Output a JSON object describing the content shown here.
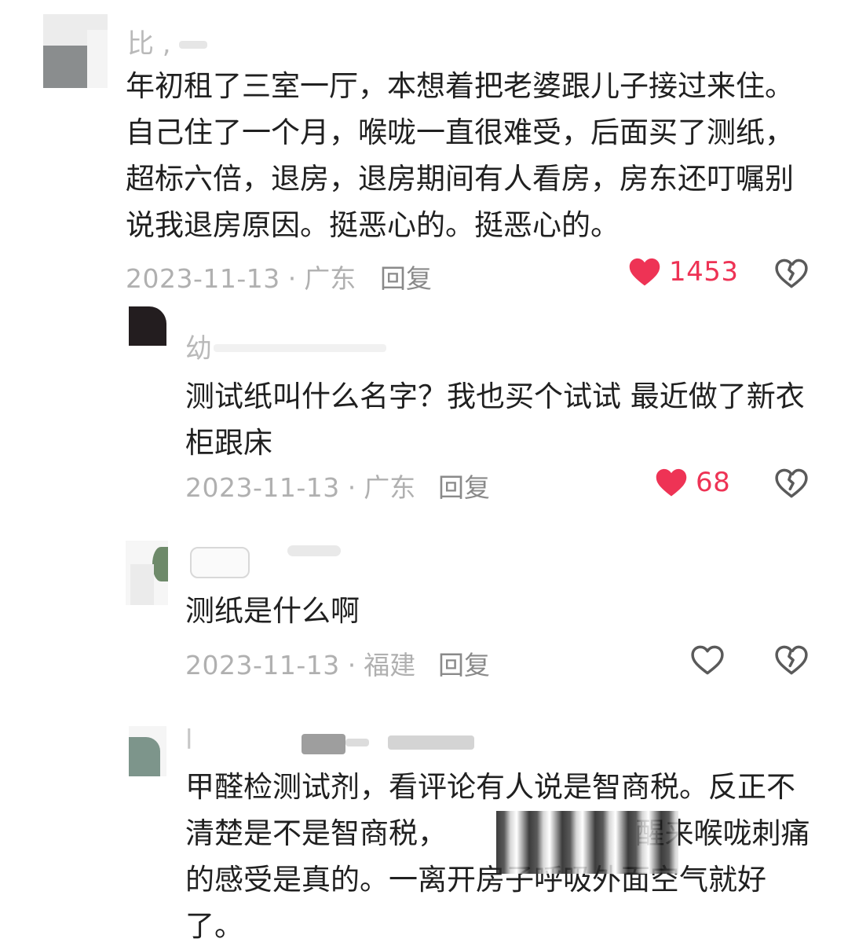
{
  "colors": {
    "like_active": "#ee3355",
    "icon_gray": "#5a5a5a",
    "meta_gray": "#b0b0b0"
  },
  "comments": [
    {
      "username": "比 ,",
      "text": "年初租了三室一厅，本想着把老婆跟儿子接过来住。自己住了一个月，喉咙一直很难受，后面买了测纸，超标六倍，退房，退房期间有人看房，房东还叮嘱别说我退房原因。挺恶心的。挺恶心的。",
      "date": "2023-11-13",
      "location": "广东",
      "reply_label": "回复",
      "likes": "1453",
      "liked": true,
      "like_icon": "heart-filled-icon",
      "dislike_icon": "broken-heart-icon"
    },
    {
      "username": "幼",
      "text": "测试纸叫什么名字？我也买个试试 最近做了新衣柜跟床",
      "date": "2023-11-13",
      "location": "广东",
      "reply_label": "回复",
      "likes": "68",
      "liked": true,
      "like_icon": "heart-filled-icon",
      "dislike_icon": "broken-heart-icon"
    },
    {
      "username": "",
      "text": "测纸是什么啊",
      "date": "2023-11-13",
      "location": "福建",
      "reply_label": "回复",
      "likes": "",
      "liked": false,
      "like_icon": "heart-outline-icon",
      "dislike_icon": "broken-heart-icon"
    },
    {
      "username": "l",
      "text": "甲醛检测试剂，看评论有人说是智商税。反正不清楚是不是智商税，　　　　　　　醒来喉咙刺痛的感受是真的。一离开房子呼吸外面空气就好了。",
      "date": "",
      "location": "",
      "reply_label": "",
      "likes": "",
      "liked": false
    }
  ]
}
